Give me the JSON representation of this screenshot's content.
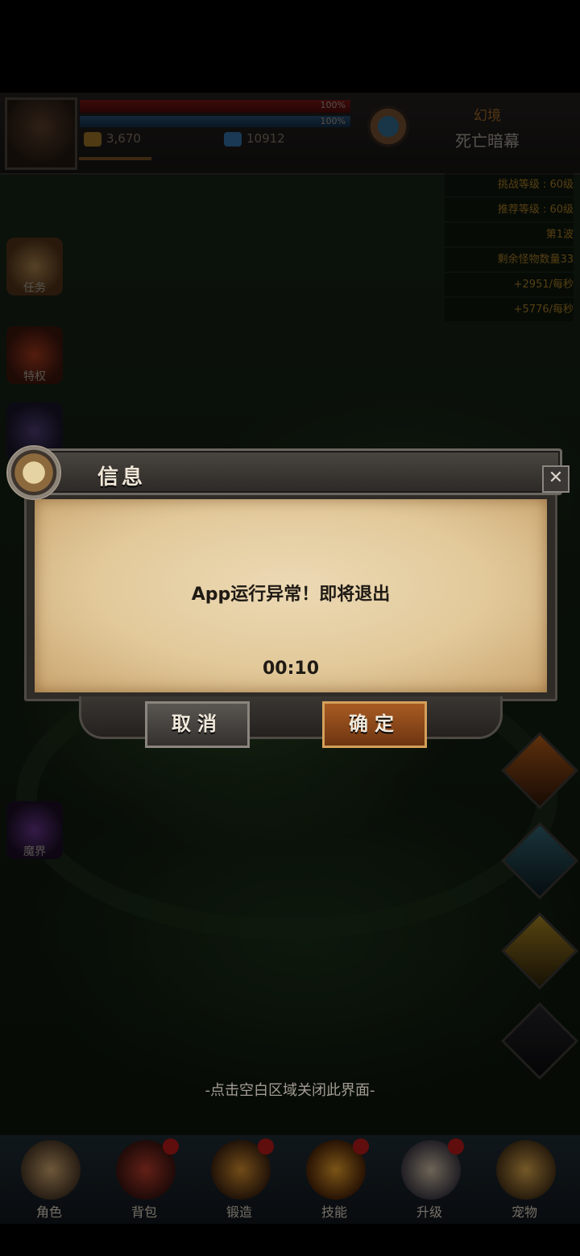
{
  "hud": {
    "hp_percent": "100%",
    "mp_percent": "100%",
    "gold": "3,670",
    "gems": "10912",
    "zone_type": "幻境",
    "zone_name": "死亡暗幕"
  },
  "info_list": [
    "挑战等级 : 60级",
    "推荐等级 : 60级",
    "第1波",
    "剩余怪物数量33",
    "+2951/每秒",
    "+5776/每秒"
  ],
  "side_buttons": [
    "任务",
    "特权",
    "",
    "",
    "",
    "魔界"
  ],
  "bottom_nav": [
    "角色",
    "背包",
    "锻造",
    "技能",
    "升级",
    "宠物"
  ],
  "dialog": {
    "title": "信息",
    "close_symbol": "✕",
    "message": "App运行异常！即将退出",
    "countdown": "00:10",
    "cancel_label": "取消",
    "ok_label": "确定"
  },
  "hint": "-点击空白区域关闭此界面-",
  "colors": {
    "ok_button": "#a85b22",
    "cancel_button": "#5a5652",
    "parchment": "#e2c99a",
    "accent_gold": "#c8952b"
  }
}
